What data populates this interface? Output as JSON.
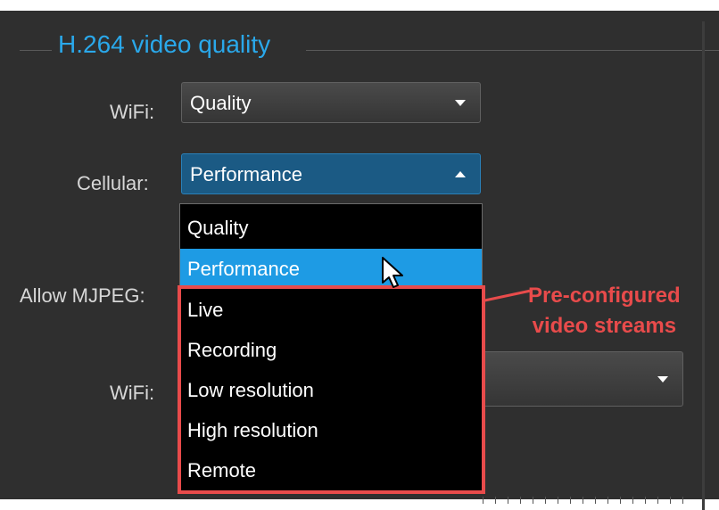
{
  "group": {
    "title": "H.264 video quality"
  },
  "h264": {
    "wifi_label": "WiFi:",
    "wifi_value": "Quality",
    "cellular_label": "Cellular:",
    "cellular_value": "Performance"
  },
  "mjpeg": {
    "allow_label": "Allow MJPEG:",
    "wifi_label": "WiFi:"
  },
  "dropdown": {
    "options": [
      "Quality",
      "Performance",
      "Live",
      "Recording",
      "Low resolution",
      "High resolution",
      "Remote"
    ],
    "selected_index": 1
  },
  "annotation": {
    "line1": "Pre-configured",
    "line2": "video streams",
    "color": "#e84b4b"
  },
  "colors": {
    "accent": "#2aa8ea",
    "selected": "#1e9be4",
    "panel": "#2f2f2f"
  }
}
